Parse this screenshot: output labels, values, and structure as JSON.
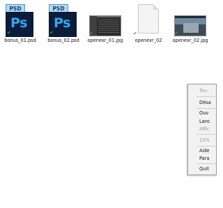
{
  "files": [
    {
      "name": "bonus_01.psd",
      "icon": "psd-file-icon",
      "badge_label": "PSD",
      "ps_label": "Ps"
    },
    {
      "name": "bonus_02.psd",
      "icon": "psd-file-icon",
      "badge_label": "PSD",
      "ps_label": "Ps"
    },
    {
      "name": "openexr_01.jpg",
      "icon": "jpg-thumbnail-icon"
    },
    {
      "name": "openexr_02",
      "icon": "blank-file-icon"
    },
    {
      "name": "openexr_02.jpg",
      "icon": "jpg-thumbnail-icon"
    }
  ],
  "context_menu": {
    "items": [
      {
        "label": "Tou",
        "disabled": true
      },
      {
        "label": "Désa",
        "disabled": false
      },
      {
        "label": "Ouv",
        "disabled": false
      },
      {
        "label": "Lanc",
        "disabled": false
      },
      {
        "label": "Affic",
        "disabled": true
      },
      {
        "label": "13%",
        "disabled": true
      },
      {
        "label": "Aide",
        "disabled": false
      },
      {
        "label": "Para",
        "disabled": false
      },
      {
        "label": "Quit",
        "disabled": false
      }
    ]
  },
  "colors": {
    "sync_check": "#3aa83a",
    "psd_blue": "#39a6f0",
    "psd_dark": "#0c1d3b"
  }
}
